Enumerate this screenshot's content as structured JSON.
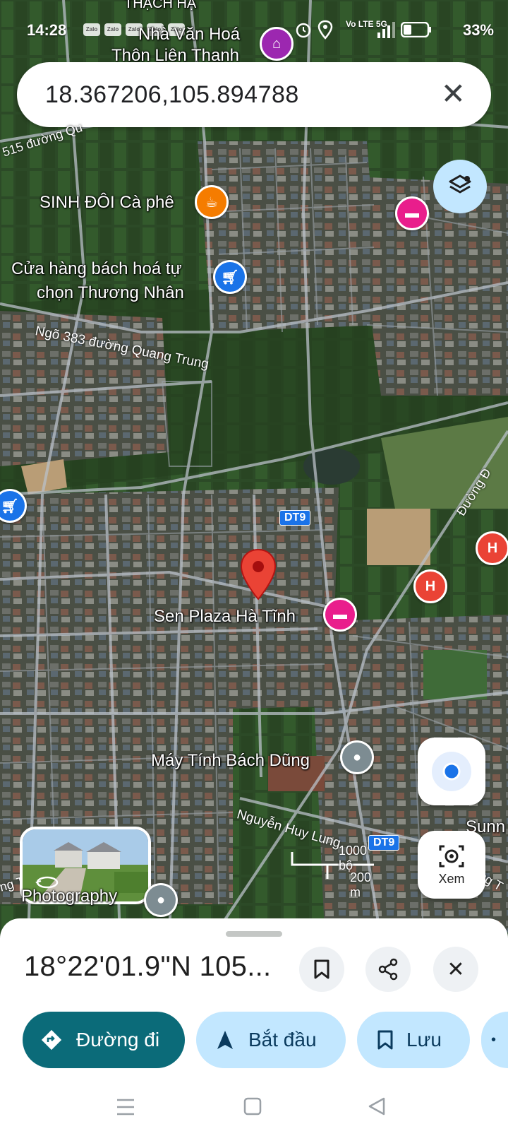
{
  "status_bar": {
    "time": "14:28",
    "notification_apps": [
      "Zalo",
      "Zalo",
      "Zalo",
      "Zalo",
      "Zalo"
    ],
    "network": "Vo LTE 5G",
    "battery": "33%"
  },
  "search": {
    "query": "18.367206,105.894788",
    "clear_icon": "close-icon"
  },
  "map": {
    "place_labels": [
      "THẠCH HẠ",
      "Nhà Văn Hoá",
      "Thôn Liên Thanh",
      "SINH ĐÔI Cà phê",
      "Cửa hàng bách hoá tự",
      "chọn Thương Nhân",
      "Sen Plaza Hà Tĩnh",
      "Máy Tính Bách Dũng",
      "Photography",
      "Sunn"
    ],
    "road_labels": [
      "515 đường Qu",
      "Ngõ 383 đường Quang Trung",
      "Nguyễn Huy Lung",
      "Đường Đ",
      "ng T",
      "ng T"
    ],
    "road_shields": [
      "DT9",
      "DT9"
    ],
    "hotel_marker": "H",
    "scale": {
      "imperial": "1000 bộ",
      "metric": "200 m"
    },
    "colors": {
      "pin": "#ea4335",
      "hotel": "#ea4335",
      "lodging": "#e91e8c",
      "cafe": "#f57c00",
      "shop": "#1a73e8",
      "community": "#9c27b0",
      "road_shield": "#1a73e8"
    }
  },
  "floating": {
    "layers_icon": "layers-icon",
    "my_location_icon": "my-location-icon",
    "lens_label": "Xem"
  },
  "sheet": {
    "coordinates": "18°22'01.9\"N 105...",
    "actions": {
      "directions": "Đường đi",
      "start": "Bắt đầu",
      "save": "Lưu"
    },
    "colors": {
      "primary": "#0b6b79",
      "chip": "#c2e7ff"
    }
  }
}
